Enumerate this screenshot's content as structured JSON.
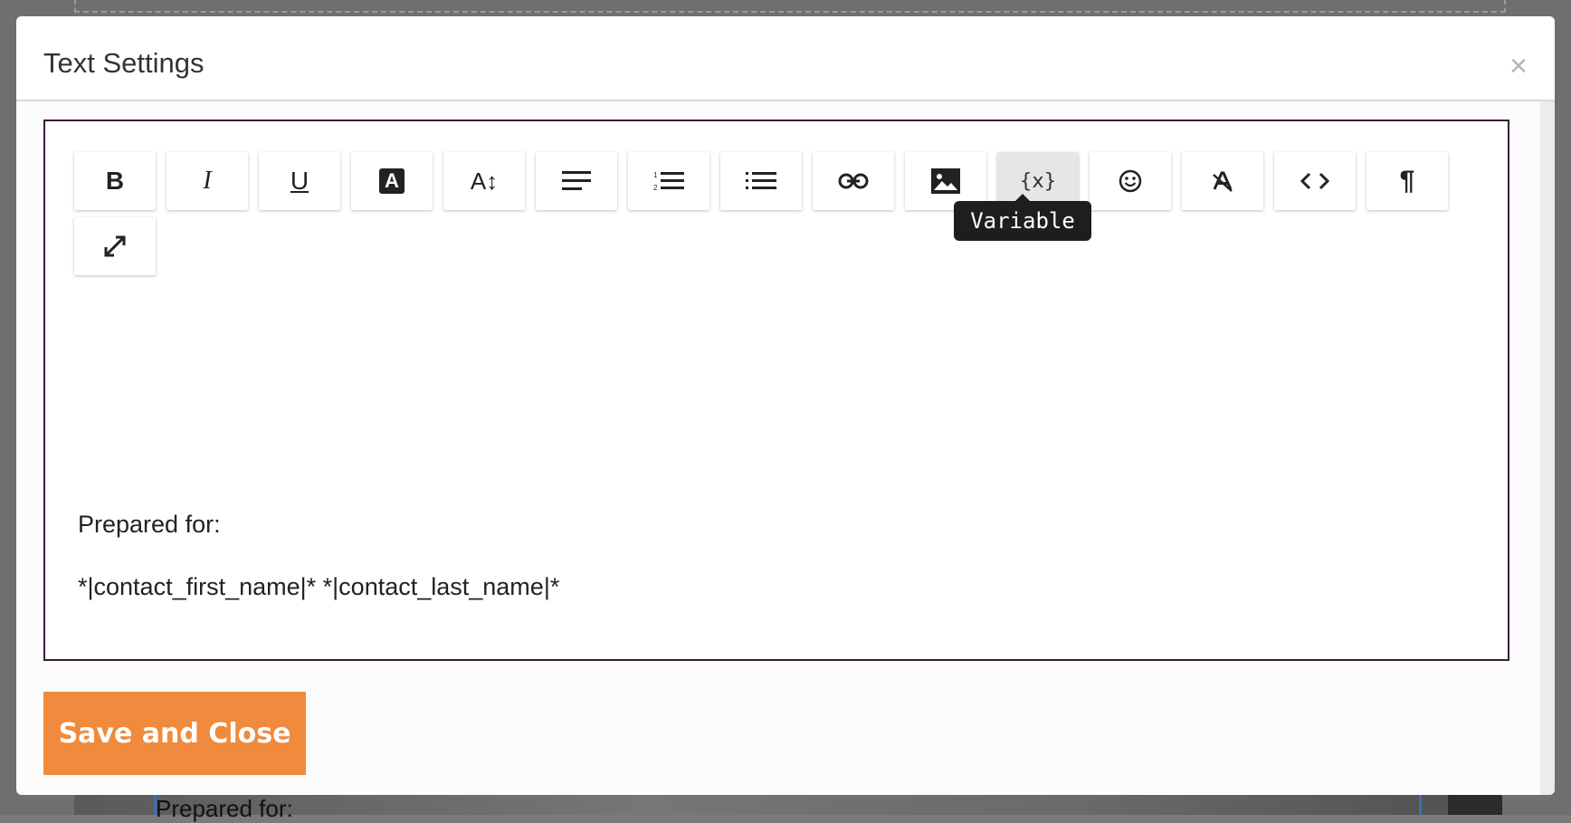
{
  "background": {
    "partial_text": "Prepared for:"
  },
  "modal": {
    "title": "Text Settings",
    "close_glyph": "×"
  },
  "toolbar": {
    "buttons": [
      {
        "name": "bold",
        "icon": "bold-icon",
        "glyph": "B"
      },
      {
        "name": "italic",
        "icon": "italic-icon",
        "glyph": "I"
      },
      {
        "name": "underline",
        "icon": "underline-icon",
        "glyph": "U"
      },
      {
        "name": "text-color",
        "icon": "text-color-icon",
        "glyph": "A"
      },
      {
        "name": "font-size",
        "icon": "font-size-icon",
        "glyph": "A↕"
      },
      {
        "name": "align",
        "icon": "align-left-icon"
      },
      {
        "name": "ordered-list",
        "icon": "ordered-list-icon"
      },
      {
        "name": "unordered-list",
        "icon": "unordered-list-icon"
      },
      {
        "name": "link",
        "icon": "link-icon"
      },
      {
        "name": "image",
        "icon": "image-icon"
      },
      {
        "name": "variable",
        "icon": "variable-icon",
        "glyph": "{x}"
      },
      {
        "name": "emoji",
        "icon": "emoji-icon",
        "glyph": "☺"
      },
      {
        "name": "clear-format",
        "icon": "clear-format-icon"
      },
      {
        "name": "code-view",
        "icon": "code-icon",
        "glyph": "<>"
      },
      {
        "name": "paragraph",
        "icon": "paragraph-icon",
        "glyph": "¶"
      },
      {
        "name": "fullscreen",
        "icon": "expand-icon"
      }
    ],
    "active_button": "variable",
    "tooltip": "Variable"
  },
  "editor": {
    "line1": "Prepared for:",
    "line2": "*|contact_first_name|* *|contact_last_name|*"
  },
  "footer": {
    "save_label": "Save and Close"
  },
  "colors": {
    "accent": "#f08a3c",
    "editor_border": "#3a1a3a",
    "overlay": "#6f6f6f"
  }
}
